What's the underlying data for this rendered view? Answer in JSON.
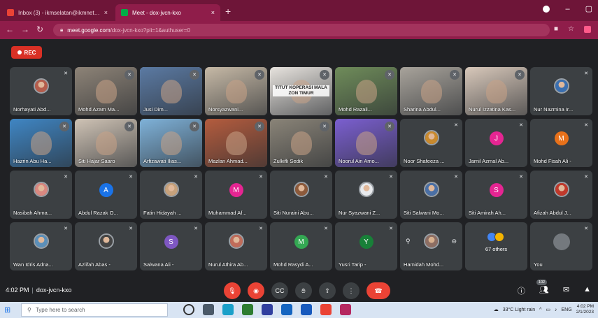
{
  "browser": {
    "tabs": [
      {
        "title": "Inbox (3) - ikmselatan@ikmnet.ed...",
        "close": "×",
        "active": false
      },
      {
        "title": "Meet - dox-jvcn-kxo",
        "close": "×",
        "active": true
      }
    ],
    "new_tab": "+",
    "url_host": "meet.google.com",
    "url_path": "/dox-jvcn-kxo?pli=1&authuser=0"
  },
  "rec_label": "REC",
  "tiles": [
    {
      "name": "Norhayati Abd...",
      "kind": "avatar-photo",
      "color": "#b55d4c"
    },
    {
      "name": "Mohd Azam Ma...",
      "kind": "video",
      "color": "#8d8377"
    },
    {
      "name": "Jusi Dim...",
      "kind": "video",
      "color": "#5b7aa3"
    },
    {
      "name": "Norsyazwani...",
      "kind": "video",
      "color": "#c6b9a6"
    },
    {
      "name": "",
      "kind": "video",
      "color": "#e7e3de",
      "overlay": "TITUT KOPERASI MALA ZON TIMUR"
    },
    {
      "name": "Mohd Razali...",
      "kind": "video",
      "color": "#6f8c5a"
    },
    {
      "name": "Sharina Abdul...",
      "kind": "video",
      "color": "#a8a39b"
    },
    {
      "name": "Nurul Izzatina Kas...",
      "kind": "video",
      "color": "#d8c8ba"
    },
    {
      "name": "Nur Nazmina Ir...",
      "kind": "avatar-photo",
      "color": "#3a6fb0"
    },
    {
      "name": "Hazrin Abu Ha...",
      "kind": "video",
      "color": "#3f86c4"
    },
    {
      "name": "Siti Hajar Saaro",
      "kind": "video",
      "color": "#cfc3b5"
    },
    {
      "name": "Arfizawati Ilias...",
      "kind": "video",
      "color": "#7fb2d9"
    },
    {
      "name": "Mazlan Ahmad...",
      "kind": "video",
      "color": "#b45c3e"
    },
    {
      "name": "Zulkifli Sedik",
      "kind": "video",
      "color": "#8a8478"
    },
    {
      "name": "Noorul Ain Amo...",
      "kind": "video",
      "color": "#7b5fd0"
    },
    {
      "name": "Noor Shafeeza ...",
      "kind": "avatar-photo",
      "color": "#c98a2e"
    },
    {
      "name": "Jamil Azmal Ab...",
      "kind": "avatar",
      "letter": "J",
      "color": "#e52592"
    },
    {
      "name": "Mohd Fisah Ali -",
      "kind": "avatar",
      "letter": "M",
      "color": "#e8711a"
    },
    {
      "name": "Nasibah Ahma...",
      "kind": "avatar-photo",
      "color": "#d98880"
    },
    {
      "name": "Abdul Razak O...",
      "kind": "avatar",
      "letter": "A",
      "color": "#1a73e8"
    },
    {
      "name": "Fatin Hidayah ...",
      "kind": "avatar-photo",
      "color": "#c7a27c"
    },
    {
      "name": "Muhammad Af...",
      "kind": "avatar",
      "letter": "M",
      "color": "#e52592"
    },
    {
      "name": "Siti Nuraini Abu...",
      "kind": "avatar-photo",
      "color": "#8d5a3b"
    },
    {
      "name": "Nur Syazwani Z...",
      "kind": "avatar-photo",
      "color": "#e8eaed"
    },
    {
      "name": "Siti Salwani Mo...",
      "kind": "avatar-photo",
      "color": "#4a6fa5"
    },
    {
      "name": "Siti Amirah Ah...",
      "kind": "avatar",
      "letter": "S",
      "color": "#e52592"
    },
    {
      "name": "Afizah Abdul J...",
      "kind": "avatar-photo",
      "color": "#c0392b"
    },
    {
      "name": "Wan Idris Adna...",
      "kind": "avatar-photo",
      "color": "#5b8fb9"
    },
    {
      "name": "Azlifah Abas -",
      "kind": "avatar-photo",
      "color": "#444"
    },
    {
      "name": "Salwana Ali -",
      "kind": "avatar",
      "letter": "S",
      "color": "#7e57c2"
    },
    {
      "name": "Nurul Athira Ab...",
      "kind": "avatar-photo",
      "color": "#c06c5a"
    },
    {
      "name": "Mohd Rasydi A...",
      "kind": "avatar",
      "letter": "M",
      "color": "#34a853"
    },
    {
      "name": "Yusri Tarip -",
      "kind": "avatar",
      "letter": "Y",
      "color": "#188038"
    },
    {
      "name": "Hamidah Mohd...",
      "kind": "hover",
      "color": "#8d6e63"
    },
    {
      "name": "67 others",
      "kind": "others"
    },
    {
      "name": "You",
      "kind": "you"
    }
  ],
  "meeting": {
    "time": "4:02 PM",
    "separator": "|",
    "code": "dox-jvcn-kxo",
    "participant_count": "102"
  },
  "taskbar": {
    "search_placeholder": "Type here to search",
    "weather": "33°C Light rain",
    "lang": "ENG",
    "time": "4:02 PM",
    "date": "2/1/2023"
  }
}
